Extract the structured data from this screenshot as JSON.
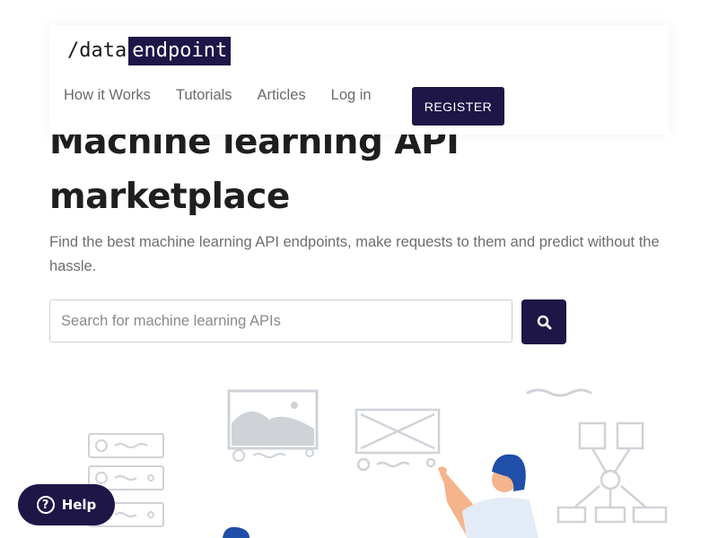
{
  "logo": {
    "prefix": "/data",
    "highlight": "endpoint"
  },
  "nav": {
    "links": [
      "How it Works",
      "Tutorials",
      "Articles",
      "Log in"
    ],
    "register_label": "REGISTER"
  },
  "hero": {
    "title_line1": "Machine learning API",
    "title_line2": "marketplace",
    "subtitle": "Find the best machine learning API endpoints, make requests to them and predict without the hassle."
  },
  "search": {
    "placeholder": "Search for machine learning APIs",
    "value": "",
    "button_icon": "search-icon"
  },
  "help": {
    "label": "Help",
    "icon": "question-circle-icon"
  },
  "colors": {
    "brand": "#1d1647",
    "text_muted": "#6e6e6e",
    "illustration": "#cfd3d8"
  }
}
